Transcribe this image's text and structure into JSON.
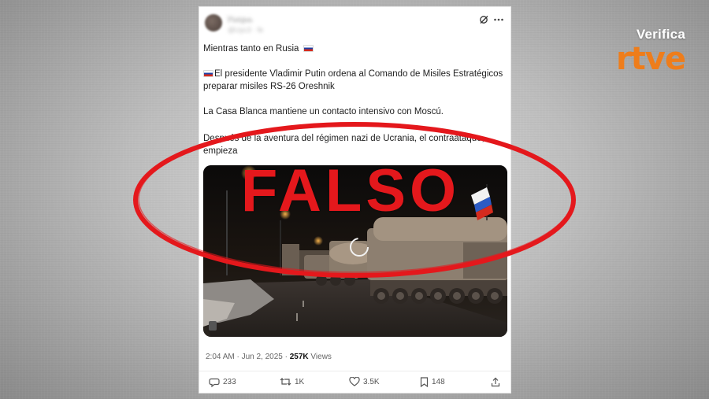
{
  "brand": {
    "top": "Verifica",
    "bottom": "rtve",
    "accent_color": "#ee7d1b"
  },
  "tweet": {
    "author_name": "Уыцьь",
    "author_meta": "@Uyc3 · fe",
    "more_icon": "more-horizontal-icon",
    "grok_icon": "grok-icon",
    "p1": "Mientras tanto en Rusia",
    "p2": "El presidente Vladimir Putin ordena al Comando de Misiles Estratégicos preparar misiles RS-26 Oreshnik",
    "p3": "La Casa Blanca mantiene un contacto intensivo con Moscú.",
    "p4": "Después de la aventura del régimen nazi de Ucrania, el contraataque, empieza",
    "flag_icon": "russia-flag-icon",
    "timestamp": "2:04 AM · Jun 2, 2025 ·",
    "views_count": "257K",
    "views_label": "Views",
    "actions": {
      "replies": "233",
      "reposts": "1K",
      "likes": "3.5K",
      "bookmarks": "148"
    }
  },
  "stamp": {
    "label": "FALSO",
    "color": "#e4181c"
  }
}
